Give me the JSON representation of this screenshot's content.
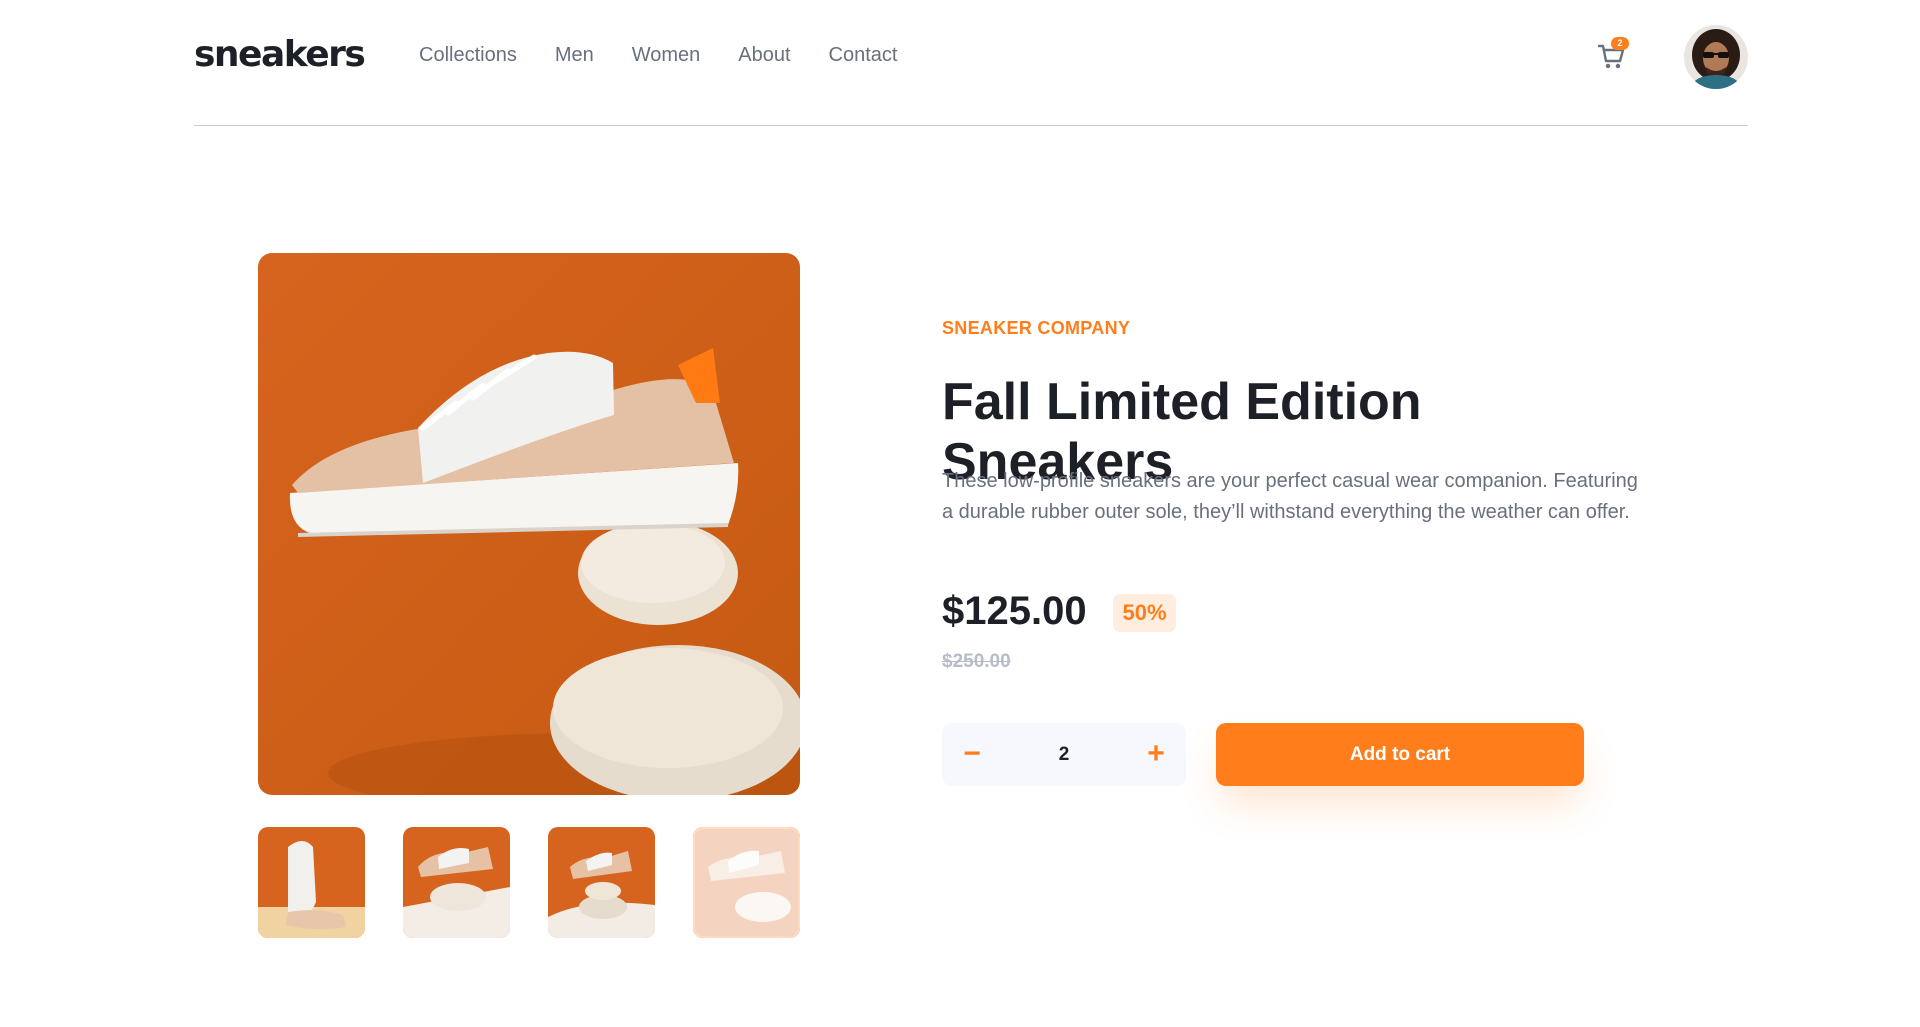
{
  "header": {
    "logo": "sneakers",
    "nav": [
      "Collections",
      "Men",
      "Women",
      "About",
      "Contact"
    ],
    "cart_count": "2",
    "cart_icon": "cart-icon",
    "avatar_icon": "user-avatar"
  },
  "product": {
    "company": "SNEAKER COMPANY",
    "title": "Fall Limited Edition Sneakers",
    "description": "These low-profile sneakers are your perfect casual wear companion. Featuring a durable rubber outer sole, they’ll withstand everything the weather can offer.",
    "price": "$125.00",
    "discount": "50%",
    "old_price": "$250.00",
    "quantity": "2",
    "minus_label": "−",
    "plus_label": "+",
    "add_to_cart": "Add to cart"
  },
  "gallery": {
    "active_thumbnail": 4
  },
  "colors": {
    "accent": "#ff7e1b",
    "accent_pale": "#ffede0",
    "text_dark": "#1d2026",
    "text_muted": "#69707d"
  }
}
